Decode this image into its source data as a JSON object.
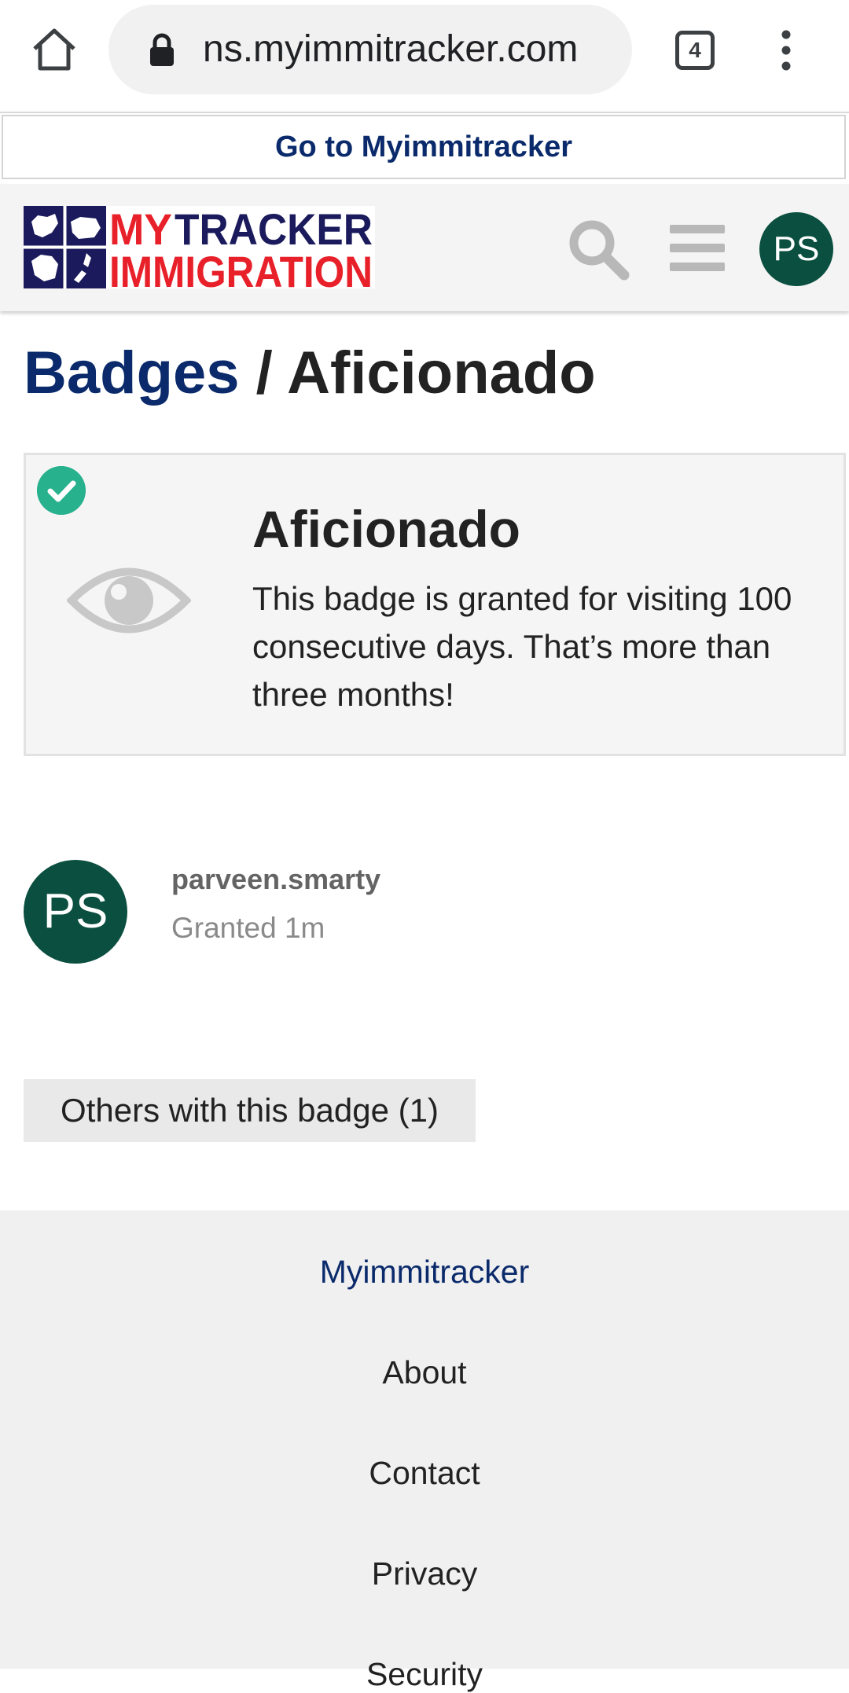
{
  "browser": {
    "url": "ns.myimmitracker.com",
    "tab_count": "4"
  },
  "banner": {
    "goto_label": "Go to Myimmitracker"
  },
  "header": {
    "logo_text_line1_a": "MY",
    "logo_text_line1_b": "TRACKER",
    "logo_text_line2": "IMMIGRATION",
    "avatar_initials": "PS"
  },
  "breadcrumb": {
    "parent": "Badges",
    "separator": " / ",
    "current": "Aficionado"
  },
  "badge": {
    "name": "Aficionado",
    "description": "This badge is granted for visiting 100 consecutive days. That’s more than three months!",
    "icon": "eye-icon",
    "status_icon": "check-circle-icon"
  },
  "grantee": {
    "initials": "PS",
    "username": "parveen.smarty",
    "granted": "Granted 1m"
  },
  "others": {
    "label": "Others with this badge (1)"
  },
  "footer": {
    "items": [
      {
        "label": "Myimmitracker"
      },
      {
        "label": "About"
      },
      {
        "label": "Contact"
      },
      {
        "label": "Privacy"
      },
      {
        "label": "Security"
      }
    ]
  },
  "colors": {
    "brand_navy": "#0a2a6b",
    "brand_red": "#e8202a",
    "avatar_green": "#0a4f3f",
    "check_teal": "#27b18d"
  }
}
